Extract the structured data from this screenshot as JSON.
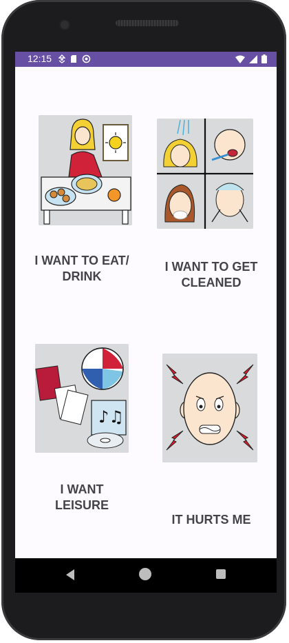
{
  "status_bar": {
    "time": "12:15",
    "left_icons": [
      "data-saver-icon",
      "sd-card-icon",
      "sync-icon"
    ],
    "right_icons": [
      "wifi-icon",
      "cell-signal-icon",
      "battery-icon"
    ],
    "color": "#6750a4"
  },
  "grid": {
    "items": [
      {
        "label": "I WANT TO EAT/\nDRINK",
        "icon": "eat-drink-pictogram"
      },
      {
        "label": "I WANT TO GET\nCLEANED",
        "icon": "cleaning-pictogram"
      },
      {
        "label": "I WANT\nLEISURE",
        "icon": "leisure-pictogram"
      },
      {
        "label": "IT HURTS ME",
        "icon": "pain-pictogram"
      }
    ]
  },
  "nav_bar": {
    "buttons": [
      "back-icon",
      "home-icon",
      "recents-icon"
    ]
  }
}
